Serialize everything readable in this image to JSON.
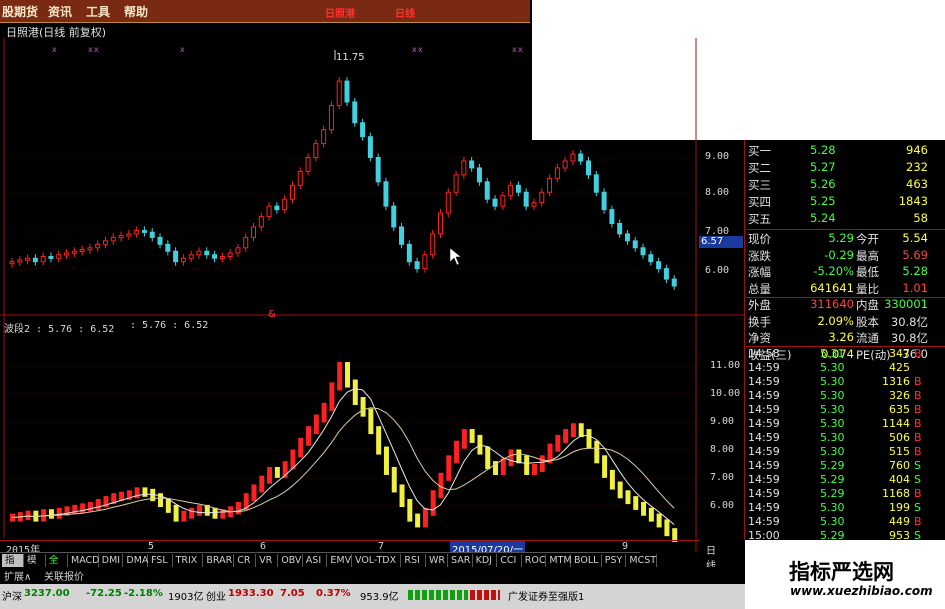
{
  "menu": {
    "items": [
      "股期货",
      "资讯",
      "工具",
      "帮助"
    ],
    "highlight": [
      "日照港",
      "日线"
    ]
  },
  "chart_title": "日照港(日线 前复权)",
  "price_annotation_high": "11.75",
  "indicator_label": "波段2 : 5.76 : 6.52",
  "indicator_label2": ": 5.76 : 6.52",
  "marker_amp": "&",
  "axis_upper": [
    "9.00",
    "8.00",
    "7.00",
    "6.00"
  ],
  "axis_lower": [
    "11.00",
    "10.00",
    "9.00",
    "8.00",
    "7.00",
    "6.00"
  ],
  "current_price_tag": "6.57",
  "x_labels": [
    "2015年",
    "5",
    "6",
    "7",
    "2015/07/20/一",
    "9"
  ],
  "period_label": "日线",
  "order_book": [
    {
      "label": "买一",
      "price": "5.28",
      "vol": "946"
    },
    {
      "label": "买二",
      "price": "5.27",
      "vol": "232"
    },
    {
      "label": "买三",
      "price": "5.26",
      "vol": "463"
    },
    {
      "label": "买四",
      "price": "5.25",
      "vol": "1843"
    },
    {
      "label": "买五",
      "price": "5.24",
      "vol": "58"
    }
  ],
  "quote": [
    {
      "l1": "现价",
      "v1": "5.29",
      "l2": "今开",
      "v2": "5.54",
      "c1": "#40ff40",
      "c2": "#ffff40"
    },
    {
      "l1": "涨跌",
      "v1": "-0.29",
      "l2": "最高",
      "v2": "5.69",
      "c1": "#40ff40",
      "c2": "#ff4040"
    },
    {
      "l1": "涨幅",
      "v1": "-5.20%",
      "l2": "最低",
      "v2": "5.28",
      "c1": "#40ff40",
      "c2": "#40ff40"
    },
    {
      "l1": "总量",
      "v1": "641641",
      "l2": "量比",
      "v2": "1.01",
      "c1": "#ffff40",
      "c2": "#ff4040"
    },
    {
      "l1": "外盘",
      "v1": "311640",
      "l2": "内盘",
      "v2": "330001",
      "c1": "#ff4040",
      "c2": "#40ff40"
    },
    {
      "l1": "换手",
      "v1": "2.09%",
      "l2": "股本",
      "v2": "30.8亿",
      "c1": "#ffff40",
      "c2": "#e0e0e0"
    },
    {
      "l1": "净资",
      "v1": "3.26",
      "l2": "流通",
      "v2": "30.8亿",
      "c1": "#ffff40",
      "c2": "#e0e0e0"
    },
    {
      "l1": "收益(三)",
      "v1": "0.074",
      "l2": "PE(动)",
      "v2": "36.0",
      "c1": "#ffff40",
      "c2": "#e0e0e0"
    }
  ],
  "ticks": [
    {
      "t": "14:58",
      "p": "5.31",
      "v": "347",
      "s": "B"
    },
    {
      "t": "14:59",
      "p": "5.30",
      "v": "425",
      "s": ""
    },
    {
      "t": "14:59",
      "p": "5.30",
      "v": "1316",
      "s": "B"
    },
    {
      "t": "14:59",
      "p": "5.30",
      "v": "326",
      "s": "B"
    },
    {
      "t": "14:59",
      "p": "5.30",
      "v": "635",
      "s": "B"
    },
    {
      "t": "14:59",
      "p": "5.30",
      "v": "1144",
      "s": "B"
    },
    {
      "t": "14:59",
      "p": "5.30",
      "v": "506",
      "s": "B"
    },
    {
      "t": "14:59",
      "p": "5.30",
      "v": "515",
      "s": "B"
    },
    {
      "t": "14:59",
      "p": "5.29",
      "v": "760",
      "s": "S"
    },
    {
      "t": "14:59",
      "p": "5.29",
      "v": "404",
      "s": "S"
    },
    {
      "t": "14:59",
      "p": "5.29",
      "v": "1168",
      "s": "B"
    },
    {
      "t": "14:59",
      "p": "5.30",
      "v": "199",
      "s": "S"
    },
    {
      "t": "14:59",
      "p": "5.30",
      "v": "449",
      "s": "B"
    },
    {
      "t": "15:00",
      "p": "5.29",
      "v": "953",
      "s": "S"
    }
  ],
  "tabs": [
    "指标",
    "模板",
    "全部",
    "MACD",
    "DMI",
    "DMA",
    "FSL",
    "TRIX",
    "BRAR",
    "CR",
    "VR",
    "OBV",
    "ASI",
    "EMV",
    "VOL-TDX",
    "RSI",
    "WR",
    "SAR",
    "KDJ",
    "CCI",
    "ROC",
    "MTM",
    "BOLL",
    "PSY",
    "MCST"
  ],
  "subtabs": [
    "扩展∧",
    "关联报价"
  ],
  "status": {
    "index1_name": "沪深",
    "index1_value": "3237.00",
    "index1_change": "-72.25",
    "index1_pct": "-2.18%",
    "index1_amount": "1903亿",
    "index2_name": "创业",
    "index2_value": "1933.30",
    "index2_change": "7.05",
    "index2_pct": "0.37%",
    "index2_amount": "953.9亿",
    "broker": "广发证券至强版1"
  },
  "watermark": {
    "title": "指标严选网",
    "url": "www.xuezhibiao.com"
  },
  "colors": {
    "up": "#ff2020",
    "down": "#40d0e0",
    "yellow": "#f0f040",
    "grid": "#801010"
  }
}
